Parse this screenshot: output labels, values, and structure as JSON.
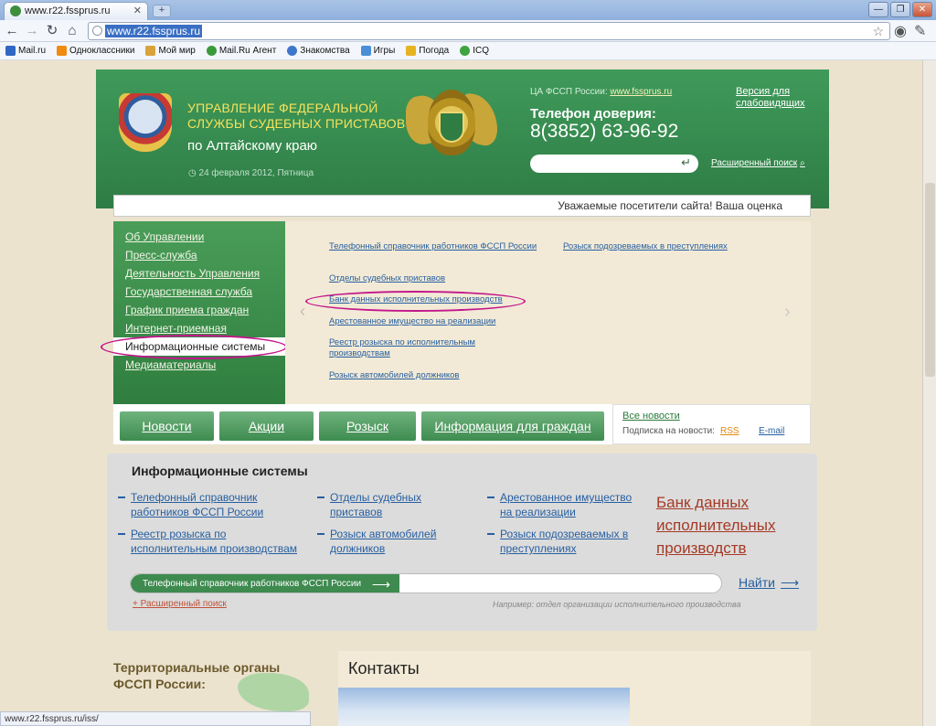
{
  "browser": {
    "tab_title": "www.r22.fssprus.ru",
    "url": "www.r22.fssprus.ru",
    "bookmarks": [
      "Mail.ru",
      "Одноклассники",
      "Мой мир",
      "Mail.Ru Агент",
      "Знакомства",
      "Игры",
      "Погода",
      "ICQ"
    ],
    "status_url": "www.r22.fssprus.ru/iss/"
  },
  "header": {
    "org_title": "УПРАВЛЕНИЕ ФЕДЕРАЛЬНОЙ СЛУЖБЫ СУДЕБНЫХ ПРИСТАВОВ",
    "org_sub": "по Алтайскому краю",
    "date": "24 февраля 2012, Пятница",
    "central_label": "ЦА ФССП России:",
    "central_link": "www.fssprus.ru",
    "hotline_label": "Телефон доверия:",
    "hotline_phone": "8(3852) 63-96-92",
    "vision_link": "Версия для слабовидящих",
    "adv_search": "Расширенный поиск"
  },
  "ticker": "Уважаемые посетители сайта! Ваша оценка",
  "menu": {
    "items": [
      "Об Управлении",
      "Пресс-служба",
      "Деятельность Управления",
      "Государственная служба",
      "График приема граждан",
      "Интернет-приемная",
      "Информационные системы",
      "Медиаматериалы"
    ]
  },
  "submenu": {
    "col1": [
      "Телефонный справочник работников ФССП России",
      "Отделы судебных приставов",
      "Банк данных исполнительных производств",
      "Арестованное имущество на реализации",
      "Реестр розыска по исполнительным производствам",
      "Розыск автомобилей должников"
    ],
    "col2": [
      "Розыск подозреваемых в преступлениях"
    ]
  },
  "tabs": [
    "Новости",
    "Акции",
    "Розыск",
    "Информация для граждан"
  ],
  "news": {
    "all": "Все новости",
    "subscribe": "Подписка на новости:",
    "rss": "RSS",
    "email": "E-mail"
  },
  "info": {
    "title": "Информационные системы",
    "links": [
      "Телефонный справочник работников ФССП России",
      "Отделы судебных приставов",
      "Арестованное имущество на реализации",
      "Реестр розыска по исполнительным производствам",
      "Розыск автомобилей должников",
      "Розыск подозреваемых в преступлениях"
    ],
    "bank": "Банк данных исполнительных производств",
    "search_label": "Телефонный справочник работников ФССП России",
    "find": "Найти",
    "adv_search": "Расширенный поиск",
    "example": "Например: отдел организации исполнительного производства"
  },
  "bottom": {
    "territorial": "Территориальные органы ФССП России:",
    "contacts": "Контакты"
  },
  "colors": {
    "header_green": "#2e7c45",
    "title_yellow": "#f6e25c",
    "link_blue": "#275fa1",
    "highlight_ring": "#c3178b",
    "bank_red": "#a53a26"
  }
}
